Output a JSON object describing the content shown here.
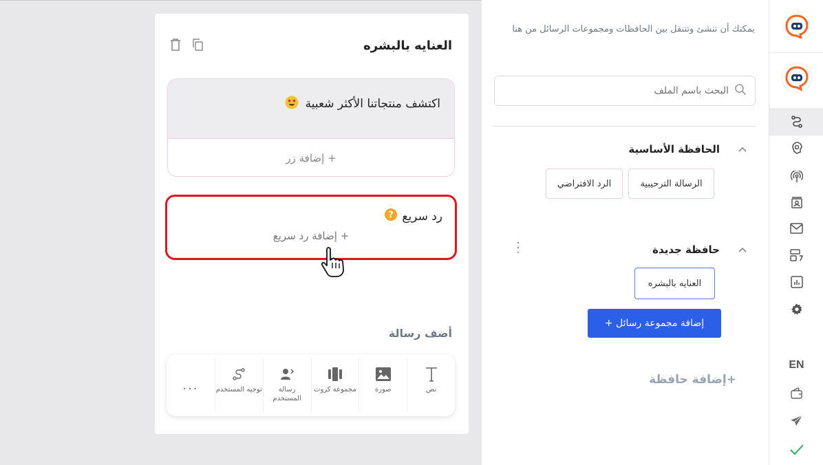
{
  "rail": {
    "language": "EN",
    "icons": [
      "bot-logo-icon",
      "flow-icon",
      "brain-gear-icon",
      "broadcast-icon",
      "contacts-icon",
      "inbox-icon",
      "templates-icon",
      "analytics-icon",
      "settings-icon",
      "wallet-icon",
      "send-icon",
      "check-icon"
    ],
    "accent": "#f26522"
  },
  "sidebar": {
    "intro": "يمكنك أن تنشئ وتتنقل بين الحافظات ومجموعات الرسائل من هنا",
    "search_placeholder": "البحث باسم الملف",
    "folders": [
      {
        "title": "الحافظة الأساسية",
        "items": [
          "الرسالة الترحيبية",
          "الرد الافتراضي"
        ]
      },
      {
        "title": "حافظة جديدة",
        "items": [
          "العنايه بالبشره"
        ]
      }
    ],
    "add_group_label": "إضافة مجموعة رسائل +",
    "add_folder_label": "+إضافة حافظة"
  },
  "editor": {
    "title": "العنايه بالبشره",
    "message_text": "اكتشف منتجاتنا الأكثر شعبية",
    "add_button_label": "+ إضافة زر",
    "quick_reply_title": "رد سريع",
    "add_quick_reply_label": "+ إضافة رد سريع",
    "add_message_heading": "أضف رسالة",
    "tools": [
      {
        "label": "نص",
        "icon": "text-icon"
      },
      {
        "label": "صورة",
        "icon": "image-icon"
      },
      {
        "label": "مجموعة كروت",
        "icon": "carousel-icon"
      },
      {
        "label": "رسالة المستخدم",
        "icon": "user-message-icon"
      },
      {
        "label": "توجيه المستخدم",
        "icon": "route-icon"
      }
    ],
    "more": "..."
  },
  "colors": {
    "primary": "#2b5fe6",
    "highlight": "#e3141e"
  }
}
